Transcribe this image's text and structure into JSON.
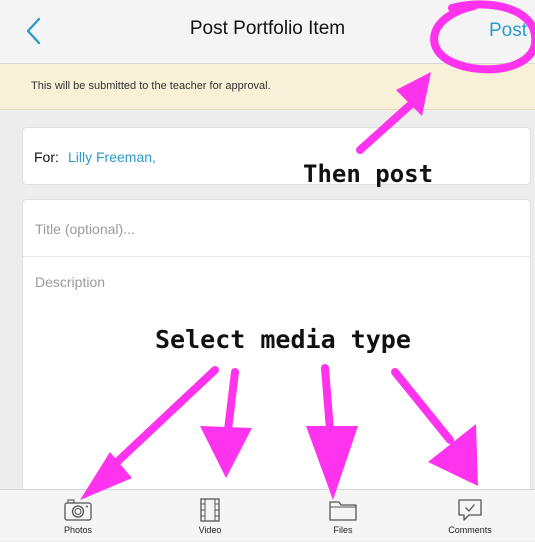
{
  "nav": {
    "title": "Post Portfolio Item",
    "post_label": "Post"
  },
  "notice": {
    "text": "This will be submitted to the teacher for approval."
  },
  "form": {
    "for_label": "For:",
    "for_value": "Lilly Freeman,",
    "title_placeholder": "Title (optional)...",
    "description_placeholder": "Description"
  },
  "annotations": {
    "then_post": "Then post",
    "select_media": "Select media type",
    "color": "#ff33ee"
  },
  "tabs": [
    {
      "label": "Photos",
      "icon": "camera-icon"
    },
    {
      "label": "Video",
      "icon": "film-icon"
    },
    {
      "label": "Files",
      "icon": "folder-icon"
    },
    {
      "label": "Comments",
      "icon": "comment-icon"
    }
  ],
  "colors": {
    "accent": "#2b9bc9",
    "notice_bg": "#f8f1d8"
  }
}
